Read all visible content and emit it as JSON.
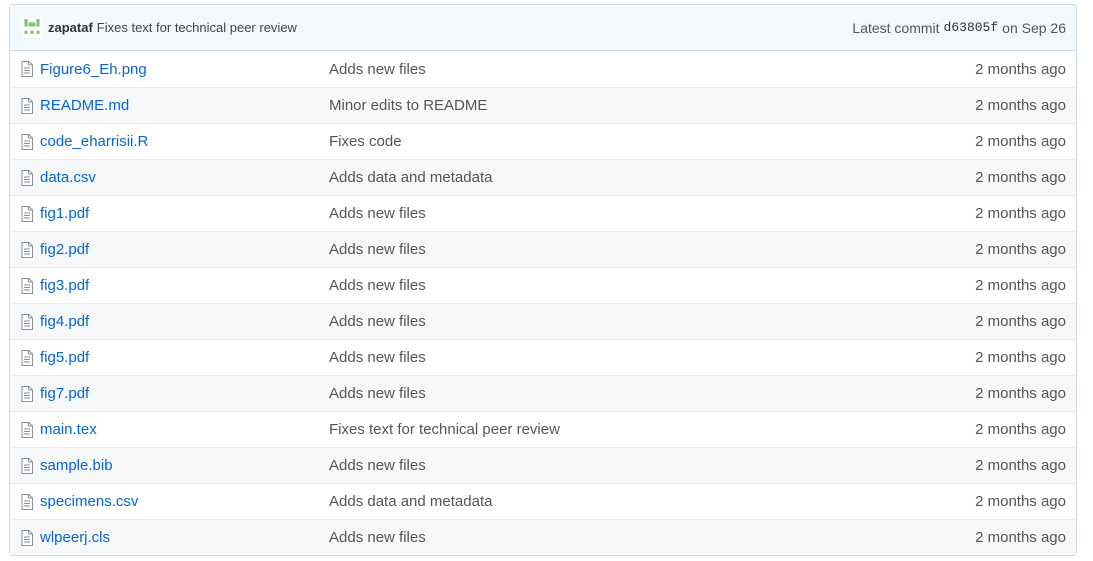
{
  "commit": {
    "author": "zapataf",
    "message": "Fixes text for technical peer review",
    "latest_label": "Latest commit",
    "sha": "d63805f",
    "date": "on Sep 26"
  },
  "files": [
    {
      "name": "Figure6_Eh.png",
      "message": "Adds new files",
      "age": "2 months ago"
    },
    {
      "name": "README.md",
      "message": "Minor edits to README",
      "age": "2 months ago"
    },
    {
      "name": "code_eharrisii.R",
      "message": "Fixes code",
      "age": "2 months ago"
    },
    {
      "name": "data.csv",
      "message": "Adds data and metadata",
      "age": "2 months ago"
    },
    {
      "name": "fig1.pdf",
      "message": "Adds new files",
      "age": "2 months ago"
    },
    {
      "name": "fig2.pdf",
      "message": "Adds new files",
      "age": "2 months ago"
    },
    {
      "name": "fig3.pdf",
      "message": "Adds new files",
      "age": "2 months ago"
    },
    {
      "name": "fig4.pdf",
      "message": "Adds new files",
      "age": "2 months ago"
    },
    {
      "name": "fig5.pdf",
      "message": "Adds new files",
      "age": "2 months ago"
    },
    {
      "name": "fig7.pdf",
      "message": "Adds new files",
      "age": "2 months ago"
    },
    {
      "name": "main.tex",
      "message": "Fixes text for technical peer review",
      "age": "2 months ago"
    },
    {
      "name": "sample.bib",
      "message": "Adds new files",
      "age": "2 months ago"
    },
    {
      "name": "specimens.csv",
      "message": "Adds data and metadata",
      "age": "2 months ago"
    },
    {
      "name": "wlpeerj.cls",
      "message": "Adds new files",
      "age": "2 months ago"
    }
  ],
  "colors": {
    "link": "#0366d6",
    "header_bg": "#f2f8fc",
    "avatar": "#7bc86c"
  }
}
